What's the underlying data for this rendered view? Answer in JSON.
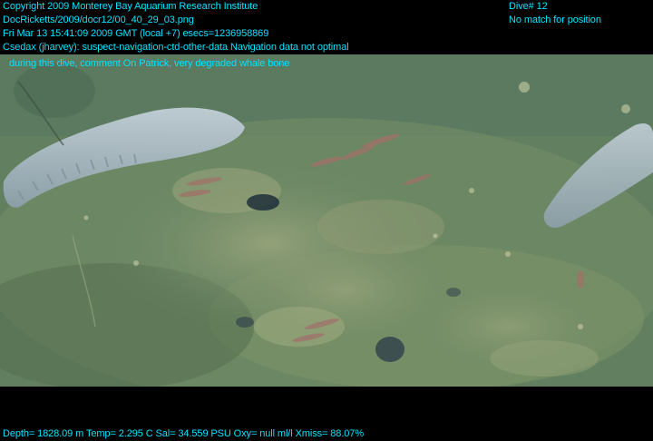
{
  "overlay": {
    "copyright": "Copyright 2009 Monterey Bay Aquarium Research Institute",
    "filename": "DocRicketts/2009/docr12/00_40_29_03.png",
    "timestamp": "Fri Mar 13 15:41:09 2009 GMT (local +7)  esecs=1236958869",
    "comment_line1": "Csedax (jharvey): suspect-navigation-ctd-other-data Navigation data not optimal",
    "comment_line2": "during this dive, comment On Patrick, very degraded whale bone",
    "dive": "Dive# 12",
    "position_status": "No match for position",
    "sensor_readout": "Depth= 1828.09 m  Temp= 2.295 C  Sal= 34.559 PSU  Oxy= null ml/l  Xmiss= 88.07%"
  },
  "colors": {
    "overlay_text": "#00e5ff",
    "background": "#000000",
    "seafloor": "#6a8569",
    "sea_cucumber": "#b8c6d2",
    "fish": "#a0706a"
  },
  "scene_elements": [
    "seafloor-sediment",
    "sea-cucumber",
    "whale-bone",
    "fish"
  ]
}
